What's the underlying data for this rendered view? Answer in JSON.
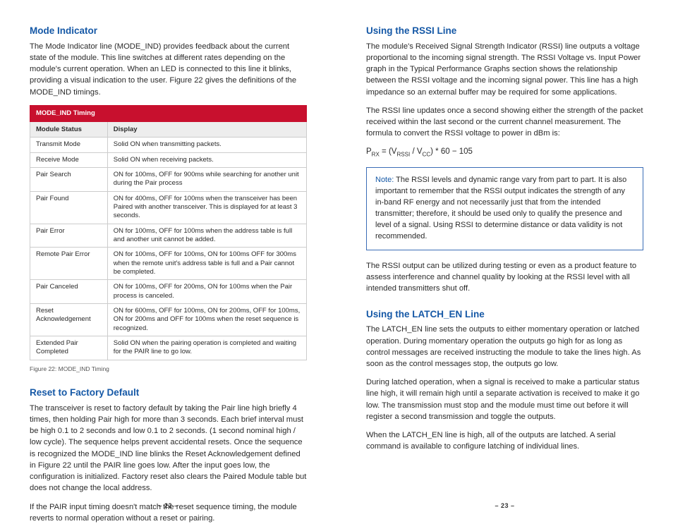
{
  "left": {
    "h1": "Mode Indicator",
    "p1": "The Mode Indicator line (MODE_IND) provides feedback about the current state of the module. This line switches at different rates depending on the module's current operation. When an LED is connected to this line it blinks, providing a visual indication to the user. Figure 22 gives the definitions of the MODE_IND timings.",
    "table_title": "MODE_IND Timing",
    "col1": "Module Status",
    "col2": "Display",
    "rows": [
      {
        "s": "Transmit Mode",
        "d": "Solid ON when transmitting packets."
      },
      {
        "s": "Receive Mode",
        "d": "Solid ON when receiving packets."
      },
      {
        "s": "Pair Search",
        "d": "ON for 100ms, OFF for 900ms while searching for another unit during the Pair process"
      },
      {
        "s": "Pair Found",
        "d": "ON for 400ms, OFF for 100ms when the transceiver has been Paired with another transceiver. This is displayed for at least 3 seconds."
      },
      {
        "s": "Pair Error",
        "d": "ON for 100ms, OFF for 100ms when the address table is full and another unit cannot be added."
      },
      {
        "s": "Remote Pair Error",
        "d": "ON for 100ms, OFF for 100ms, ON for 100ms OFF for 300ms when the remote unit's address table is full and a Pair cannot be completed."
      },
      {
        "s": "Pair Canceled",
        "d": "ON for 100ms, OFF for 200ms, ON for 100ms when the Pair process is canceled."
      },
      {
        "s": "Reset Acknowledgement",
        "d": "ON for 600ms, OFF for 100ms, ON for 200ms, OFF for 100ms, ON for 200ms and OFF for 100ms when the reset sequence is recognized."
      },
      {
        "s": "Extended Pair Completed",
        "d": "Solid ON when the pairing operation is completed and waiting for the PAIR line to go low."
      }
    ],
    "caption": "Figure 22: MODE_IND Timing",
    "h2": "Reset to Factory Default",
    "p2": "The transceiver is reset to factory default by taking the Pair line high briefly 4 times, then holding Pair high for more than 3 seconds. Each brief interval must be high 0.1 to 2 seconds and low 0.1 to 2 seconds. (1 second nominal high / low cycle). The sequence helps prevent accidental resets. Once the sequence is recognized the MODE_IND line blinks the Reset Acknowledgement defined in Figure 22 until the PAIR line goes low. After the input goes low, the configuration is initialized. Factory reset also clears the Paired Module table but does not change the local address.",
    "p3": "If the PAIR input timing doesn't match the reset sequence timing, the module reverts to normal operation without a reset or pairing.",
    "pagenum": "– 22 –"
  },
  "right": {
    "h1": "Using the RSSI Line",
    "p1": "The module's Received Signal Strength Indicator (RSSI) line outputs a voltage proportional to the incoming signal strength. The RSSI Voltage vs. Input Power graph in the Typical Performance Graphs section shows the relationship between the RSSI voltage and the incoming signal power. This line has a high impedance so an external buffer may be required for some applications.",
    "p2": "The RSSI line updates once a second showing either the strength of the packet received within the last second or the current channel measurement. The formula to convert the RSSI voltage to power in dBm is:",
    "formula_prefix": "P",
    "formula_sub1": "RX",
    "formula_mid1": " = (V",
    "formula_sub2": "RSSI",
    "formula_mid2": " / V",
    "formula_sub3": "CC",
    "formula_suffix": ") * 60 − 105",
    "note_label": "Note:",
    "note": " The RSSI levels and dynamic range vary from part to part. It is also important to remember that the RSSI output indicates the strength of any in-band RF energy and not necessarily just that from the intended transmitter; therefore, it should be used only to qualify the presence and level of a signal. Using RSSI to determine distance or data validity is not recommended.",
    "p3": "The RSSI output can be utilized during testing or even as a product feature to assess interference and channel quality by looking at the RSSI level with all intended transmitters shut off.",
    "h2": "Using the LATCH_EN Line",
    "p4": "The LATCH_EN line sets the outputs to either momentary operation or latched operation. During momentary operation the outputs go high for as long as control messages are received instructing the module to take the lines high. As soon as the control messages stop, the outputs go low.",
    "p5": "During latched operation, when a signal is received to make a particular status line high, it will remain high until a separate activation is received to make it go low. The transmission must stop and the module must time out before it will register a second transmission and toggle the outputs.",
    "p6": "When the LATCH_EN line is high, all of the outputs are latched. A serial command is available to configure latching of individual lines.",
    "pagenum": "– 23 –"
  }
}
